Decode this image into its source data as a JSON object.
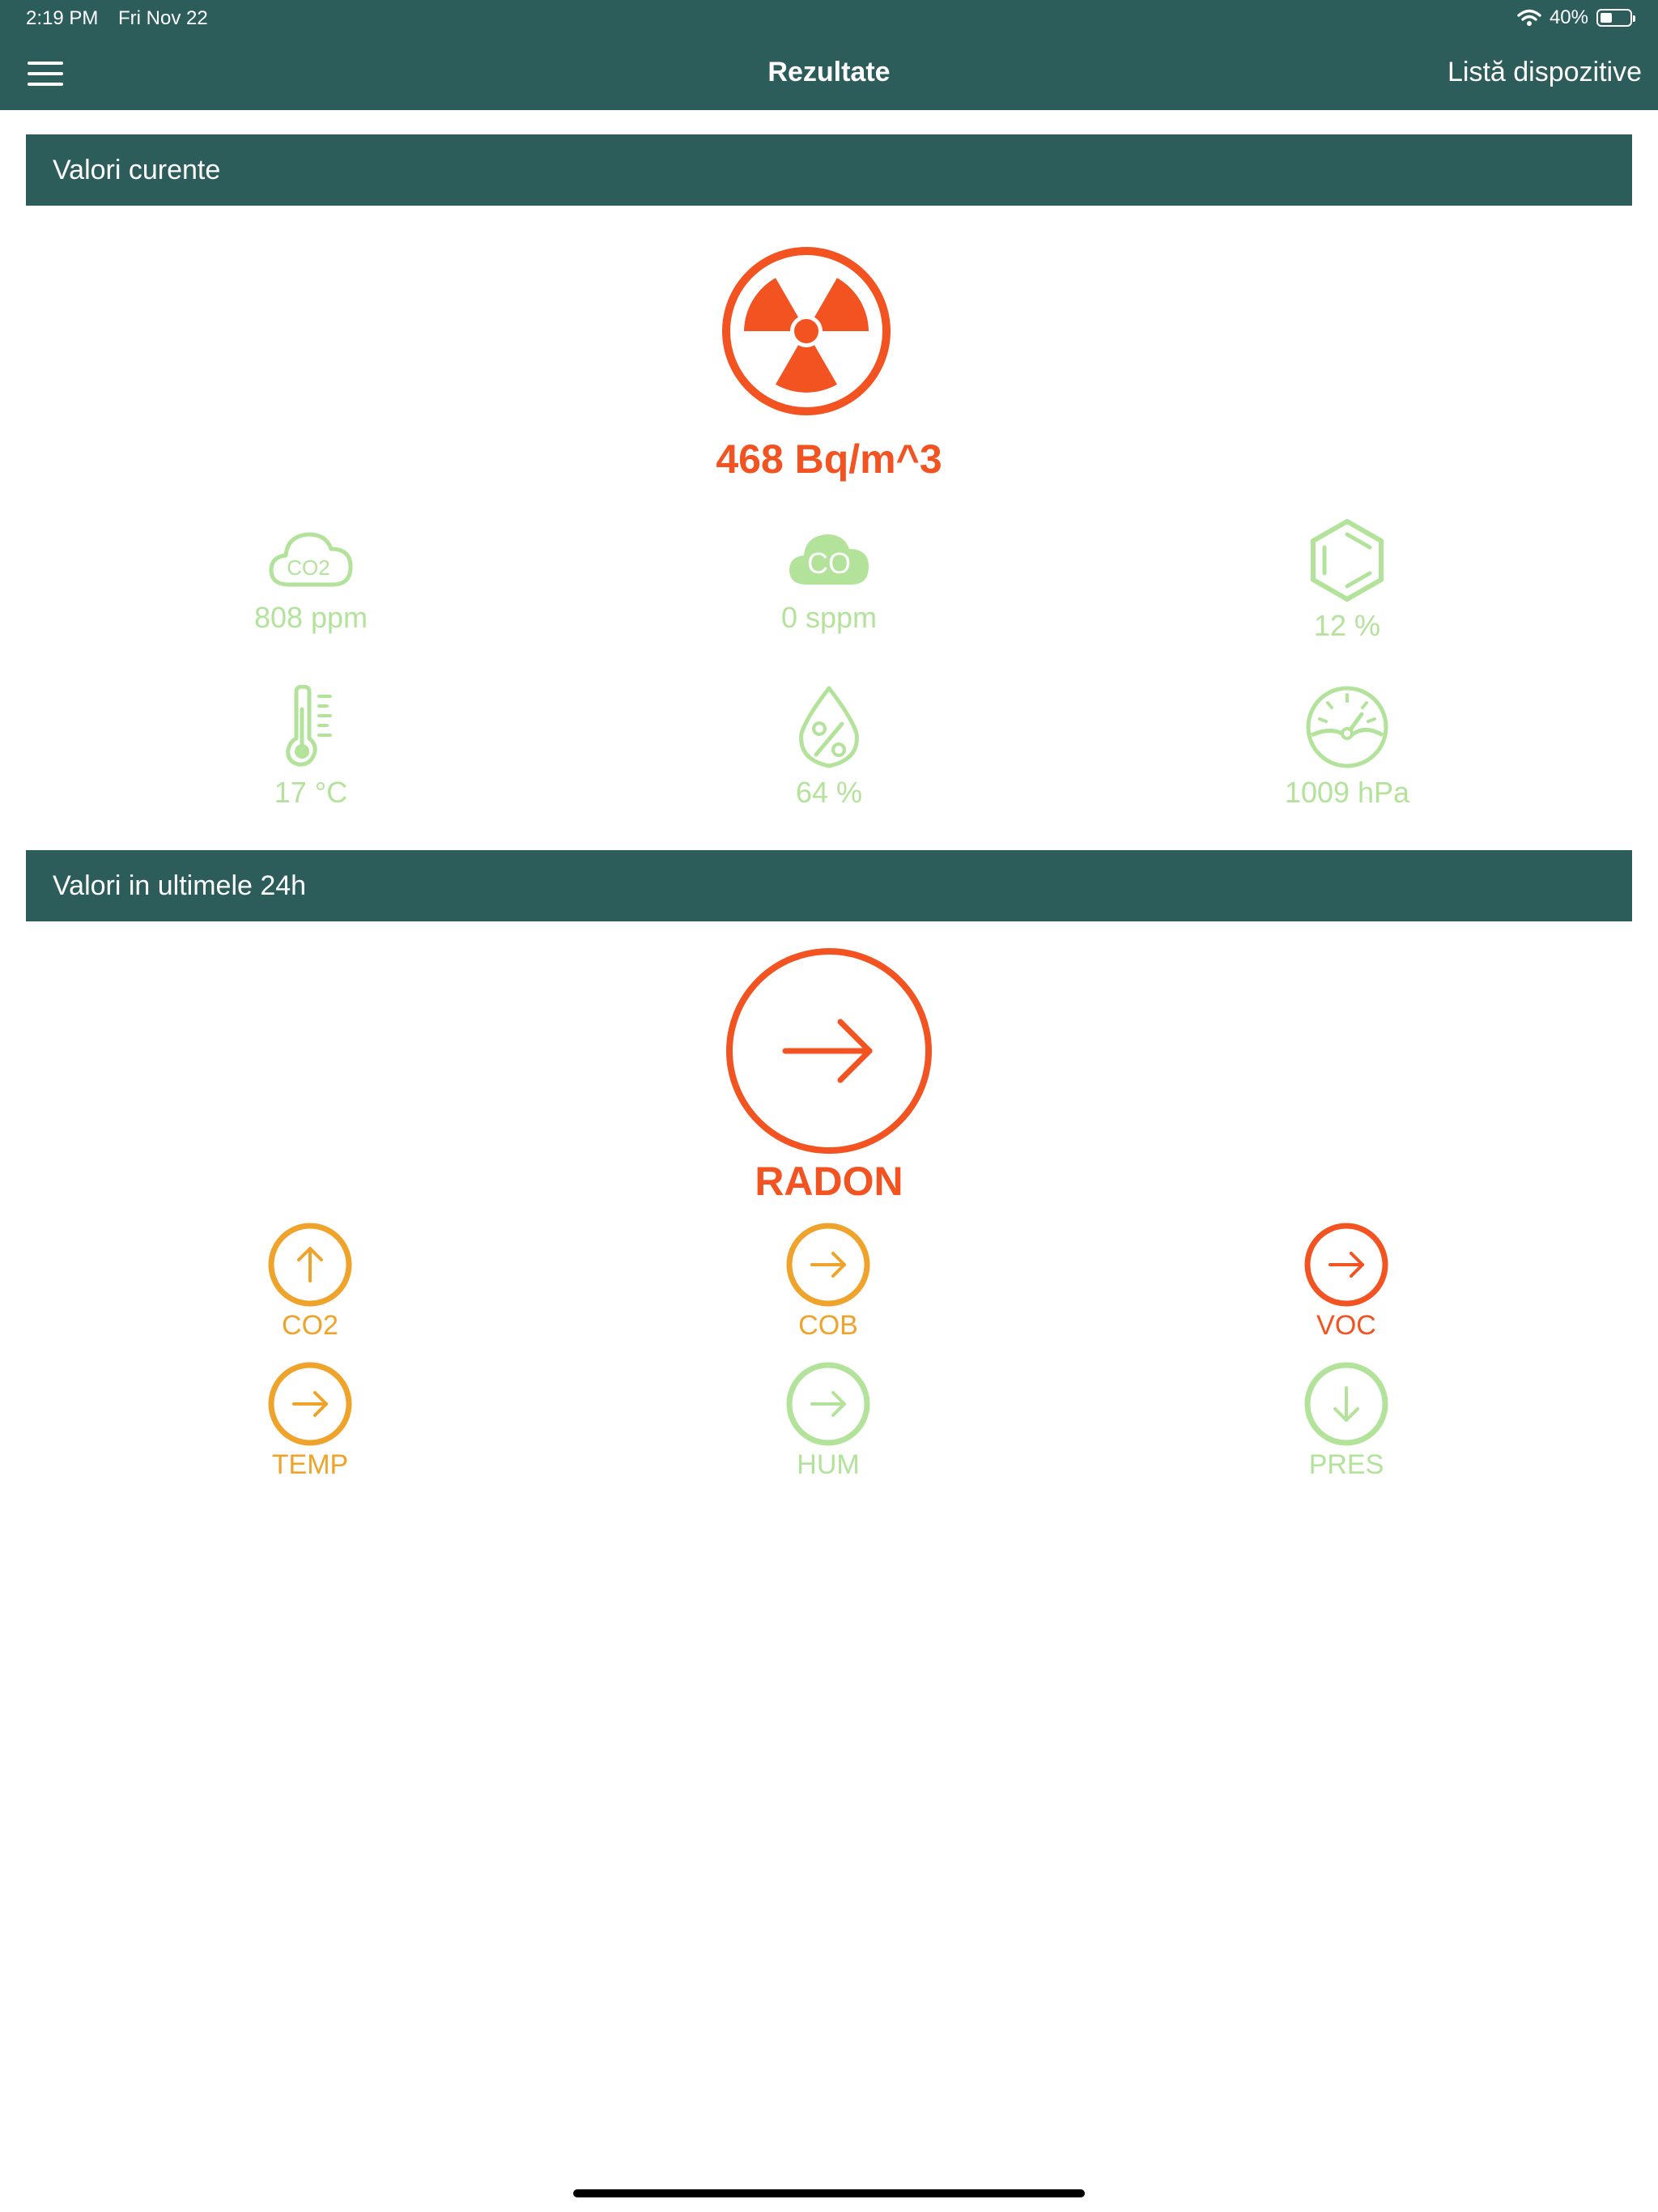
{
  "status": {
    "time": "2:19 PM",
    "date": "Fri Nov 22",
    "battery": "40%",
    "battery_level": 0.4
  },
  "nav": {
    "title": "Rezultate",
    "right_label": "Listă dispozitive"
  },
  "current": {
    "header": "Valori curente",
    "radon_value": "468 Bq/m^3",
    "metrics": [
      {
        "icon": "co2-cloud-icon",
        "icon_text": "CO2",
        "value": "808 ppm"
      },
      {
        "icon": "co-cloud-icon",
        "icon_text": "CO",
        "value": "0 sppm"
      },
      {
        "icon": "benzene-ring-icon",
        "value": "12 %"
      },
      {
        "icon": "thermometer-icon",
        "value": "17 °C"
      },
      {
        "icon": "humidity-drop-icon",
        "value": "64 %"
      },
      {
        "icon": "pressure-gauge-icon",
        "value": "1009 hPa"
      }
    ]
  },
  "last24h": {
    "header": "Valori in ultimele 24h",
    "main": {
      "label": "RADON",
      "direction": "right"
    },
    "trends": [
      {
        "label": "CO2",
        "direction": "up",
        "color": "#f0a32a"
      },
      {
        "label": "COB",
        "direction": "right",
        "color": "#f0a32a"
      },
      {
        "label": "VOC",
        "direction": "right",
        "color": "#f35221"
      },
      {
        "label": "TEMP",
        "direction": "right",
        "color": "#f0a32a"
      },
      {
        "label": "HUM",
        "direction": "right",
        "color": "#b3e39a"
      },
      {
        "label": "PRES",
        "direction": "down",
        "color": "#b3e39a"
      }
    ]
  },
  "colors": {
    "brand": "#2d5d5b",
    "alert": "#f35221",
    "warning": "#f0a32a",
    "good": "#b3e39a"
  }
}
